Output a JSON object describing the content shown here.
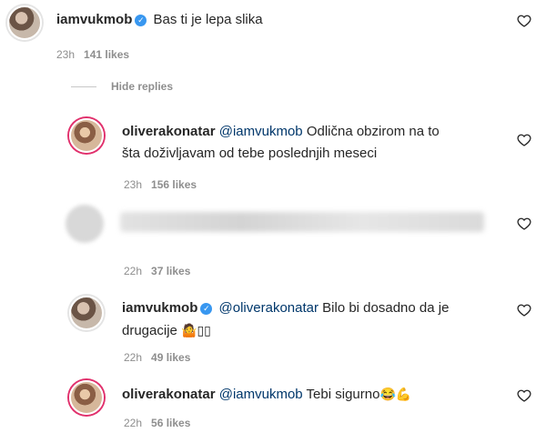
{
  "comments": [
    {
      "username": "iamvukmob",
      "verified": true,
      "mention": "",
      "text": "Bas ti je lepa slika",
      "time": "23h",
      "likes": "141 likes"
    },
    {
      "username": "oliverakonatar",
      "verified": false,
      "mention": "@iamvukmob",
      "text_line1": "Odlična obzirom na to",
      "text_line2": "šta doživljavam od tebe poslednjih meseci",
      "time": "23h",
      "likes": "156 likes"
    },
    {
      "username": "",
      "text": "",
      "time": "22h",
      "likes": "37 likes"
    },
    {
      "username": "iamvukmob",
      "verified": true,
      "mention": "@oliverakonatar",
      "text_line1": "Bilo bi dosadno da je",
      "text_line2": "drugacije",
      "emoji": "🤷▯▯",
      "time": "22h",
      "likes": "49 likes"
    },
    {
      "username": "oliverakonatar",
      "verified": false,
      "mention": "@iamvukmob",
      "text": "Tebi sigurno",
      "emoji": "😂💪",
      "time": "22h",
      "likes": "56 likes"
    }
  ],
  "hide_replies_label": "Hide replies",
  "icons": {
    "heart": "heart-outline-icon",
    "verified": "verified-badge-icon"
  }
}
